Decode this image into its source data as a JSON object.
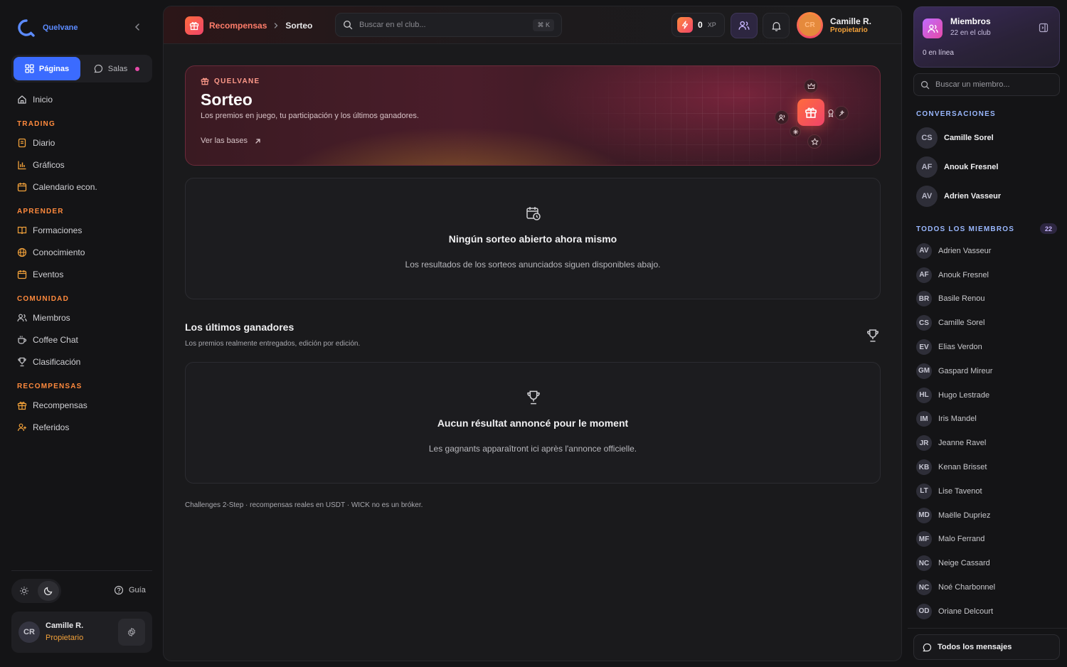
{
  "brand": {
    "name": "Quelvane",
    "color": "#5c8bff"
  },
  "sidebar": {
    "tabs": [
      {
        "label": "Páginas",
        "active": true
      },
      {
        "label": "Salas",
        "active": false
      }
    ],
    "home": "Inicio",
    "sections": [
      {
        "title": "TRADING",
        "items": [
          "Diario",
          "Gráficos",
          "Calendario econ."
        ]
      },
      {
        "title": "APRENDER",
        "items": [
          "Formaciones",
          "Conocimiento",
          "Eventos"
        ]
      },
      {
        "title": "COMUNIDAD",
        "items": [
          "Miembros",
          "Coffee Chat",
          "Clasificación"
        ]
      },
      {
        "title": "RECOMPENSAS",
        "items": [
          "Recompensas",
          "Referidos"
        ]
      }
    ],
    "guide": "Guía",
    "user": {
      "initials": "CR",
      "name": "Camille R.",
      "role": "Propietario"
    }
  },
  "topbar": {
    "breadcrumb": [
      "Recompensas",
      "Sorteo"
    ],
    "search_placeholder": "Buscar en el club...",
    "shortcut": "⌘ K",
    "xp_value": "0",
    "xp_unit": "XP",
    "user": {
      "initials": "CR",
      "name": "Camille R.",
      "role": "Propietario"
    }
  },
  "hero": {
    "kicker": "QUELVANE",
    "title": "Sorteo",
    "subtitle": "Los premios en juego, tu participación y los últimos ganadores.",
    "link": "Ver las bases"
  },
  "empty_open": {
    "title": "Ningún sorteo abierto ahora mismo",
    "subtitle": "Los resultados de los sorteos anunciados siguen disponibles abajo."
  },
  "winners": {
    "title": "Los últimos ganadores",
    "subtitle": "Los premios realmente entregados, edición por edición.",
    "empty_title": "Aucun résultat annoncé pour le moment",
    "empty_subtitle": "Les gagnants apparaîtront ici après l'annonce officielle."
  },
  "footnote": "Challenges 2-Step · recompensas reales en USDT · WICK no es un bróker.",
  "right_panel": {
    "members_title": "Miembros",
    "members_sub": "22 en el club",
    "online": "0 en línea",
    "search_placeholder": "Buscar un miembro...",
    "conversations_title": "CONVERSACIONES",
    "conversations": [
      {
        "initials": "CS",
        "name": "Camille Sorel"
      },
      {
        "initials": "AF",
        "name": "Anouk Fresnel"
      },
      {
        "initials": "AV",
        "name": "Adrien Vasseur"
      }
    ],
    "all_members_title": "TODOS LOS MIEMBROS",
    "all_members_count": "22",
    "members": [
      {
        "initials": "AV",
        "name": "Adrien Vasseur"
      },
      {
        "initials": "AF",
        "name": "Anouk Fresnel"
      },
      {
        "initials": "BR",
        "name": "Basile Renou"
      },
      {
        "initials": "CS",
        "name": "Camille Sorel"
      },
      {
        "initials": "EV",
        "name": "Elias Verdon"
      },
      {
        "initials": "GM",
        "name": "Gaspard Mireur"
      },
      {
        "initials": "HL",
        "name": "Hugo Lestrade"
      },
      {
        "initials": "IM",
        "name": "Iris Mandel"
      },
      {
        "initials": "JR",
        "name": "Jeanne Ravel"
      },
      {
        "initials": "KB",
        "name": "Kenan Brisset"
      },
      {
        "initials": "LT",
        "name": "Lise Tavenot"
      },
      {
        "initials": "MD",
        "name": "Maëlle Dupriez"
      },
      {
        "initials": "MF",
        "name": "Malo Ferrand"
      },
      {
        "initials": "NC",
        "name": "Neige Cassard"
      },
      {
        "initials": "NC",
        "name": "Noé Charbonnel"
      },
      {
        "initials": "OD",
        "name": "Oriane Delcourt"
      }
    ],
    "all_messages": "Todos los mensajes"
  },
  "colors": {
    "accent_orange": "#ff8a3d",
    "accent_pink": "#f0446a",
    "accent_violet": "#c9b7ff",
    "blue": "#3b6bff"
  }
}
